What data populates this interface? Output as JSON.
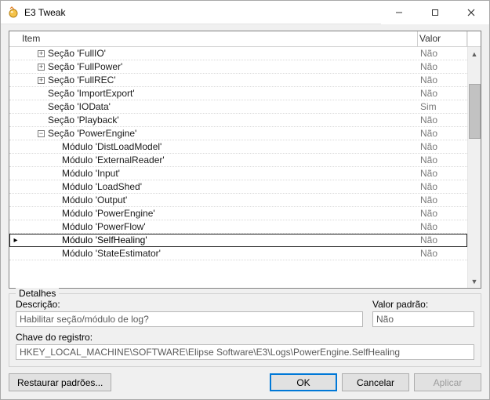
{
  "window": {
    "title": "E3 Tweak",
    "minimize_name": "minimize",
    "maximize_name": "maximize",
    "close_name": "close"
  },
  "columns": {
    "item": "Item",
    "value": "Valor"
  },
  "rows": [
    {
      "indent": 1,
      "expander": "plus",
      "label": "Seção 'FullIO'",
      "value": "Não",
      "selected": false
    },
    {
      "indent": 1,
      "expander": "plus",
      "label": "Seção 'FullPower'",
      "value": "Não",
      "selected": false
    },
    {
      "indent": 1,
      "expander": "plus",
      "label": "Seção 'FullREC'",
      "value": "Não",
      "selected": false
    },
    {
      "indent": 1,
      "expander": "none",
      "label": "Seção 'ImportExport'",
      "value": "Não",
      "selected": false
    },
    {
      "indent": 1,
      "expander": "none",
      "label": "Seção 'IOData'",
      "value": "Sim",
      "selected": false
    },
    {
      "indent": 1,
      "expander": "none",
      "label": "Seção 'Playback'",
      "value": "Não",
      "selected": false
    },
    {
      "indent": 1,
      "expander": "minus",
      "label": "Seção 'PowerEngine'",
      "value": "Não",
      "selected": false
    },
    {
      "indent": 2,
      "expander": "none",
      "label": "Módulo 'DistLoadModel'",
      "value": "Não",
      "selected": false
    },
    {
      "indent": 2,
      "expander": "none",
      "label": "Módulo 'ExternalReader'",
      "value": "Não",
      "selected": false
    },
    {
      "indent": 2,
      "expander": "none",
      "label": "Módulo 'Input'",
      "value": "Não",
      "selected": false
    },
    {
      "indent": 2,
      "expander": "none",
      "label": "Módulo 'LoadShed'",
      "value": "Não",
      "selected": false
    },
    {
      "indent": 2,
      "expander": "none",
      "label": "Módulo 'Output'",
      "value": "Não",
      "selected": false
    },
    {
      "indent": 2,
      "expander": "none",
      "label": "Módulo 'PowerEngine'",
      "value": "Não",
      "selected": false
    },
    {
      "indent": 2,
      "expander": "none",
      "label": "Módulo 'PowerFlow'",
      "value": "Não",
      "selected": false
    },
    {
      "indent": 2,
      "expander": "none",
      "label": "Módulo 'SelfHealing'",
      "value": "Não",
      "selected": true
    },
    {
      "indent": 2,
      "expander": "none",
      "label": "Módulo 'StateEstimator'",
      "value": "Não",
      "selected": false
    }
  ],
  "details": {
    "legend": "Detalhes",
    "description_label": "Descrição:",
    "description_value": "Habilitar seção/módulo de log?",
    "default_label": "Valor padrão:",
    "default_value": "Não",
    "regkey_label": "Chave do registro:",
    "regkey_value": "HKEY_LOCAL_MACHINE\\SOFTWARE\\Elipse Software\\E3\\Logs\\PowerEngine.SelfHealing"
  },
  "buttons": {
    "restore": "Restaurar padrões...",
    "ok": "OK",
    "cancel": "Cancelar",
    "apply": "Aplicar"
  }
}
